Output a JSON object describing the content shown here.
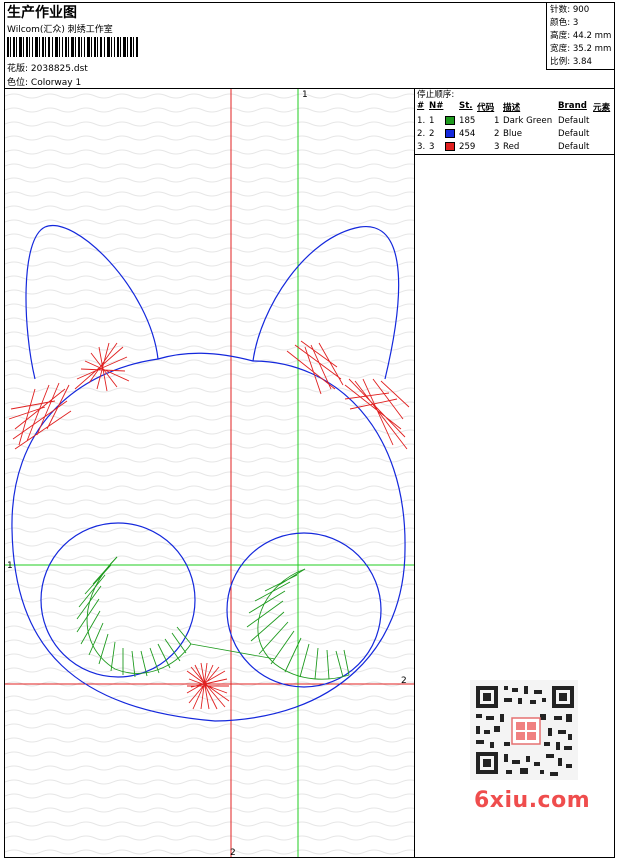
{
  "header": {
    "title": "生产作业图",
    "company": "Wilcom(汇众) 刺绣工作室",
    "design_file_label": "花版:",
    "design_file": "2038825.dst",
    "colorway_label": "色位:",
    "colorway": "Colorway 1"
  },
  "stats": {
    "stitches": "针数: 900",
    "colors": "颜色: 3",
    "height": "高度: 44.2 mm",
    "width": "宽度: 35.2 mm",
    "scale": "比例: 3.84"
  },
  "stop_sequence": {
    "title": "停止顺序:",
    "columns": [
      "#",
      "N#",
      "St.",
      "代码",
      "描述",
      "Brand",
      "元素"
    ],
    "rows": [
      {
        "num": "1.",
        "n": "1",
        "color": "#1e9a1e",
        "st": "185",
        "code": "1",
        "desc": "Dark Green",
        "brand": "Default"
      },
      {
        "num": "2.",
        "n": "2",
        "color": "#1428dc",
        "st": "454",
        "code": "2",
        "desc": "Blue",
        "brand": "Default"
      },
      {
        "num": "3.",
        "n": "3",
        "color": "#e02020",
        "st": "259",
        "code": "3",
        "desc": "Red",
        "brand": "Default"
      }
    ]
  },
  "axes": {
    "top_marker": "1",
    "left_marker": "1",
    "right_marker": "2",
    "bottom_marker": "2"
  },
  "watermark": "6xiu.com",
  "colors": {
    "outline": "#1428dc",
    "fill_green": "#1e9a1e",
    "fill_red": "#e02020",
    "axis_red": "#e02020",
    "axis_green": "#22cc22"
  }
}
